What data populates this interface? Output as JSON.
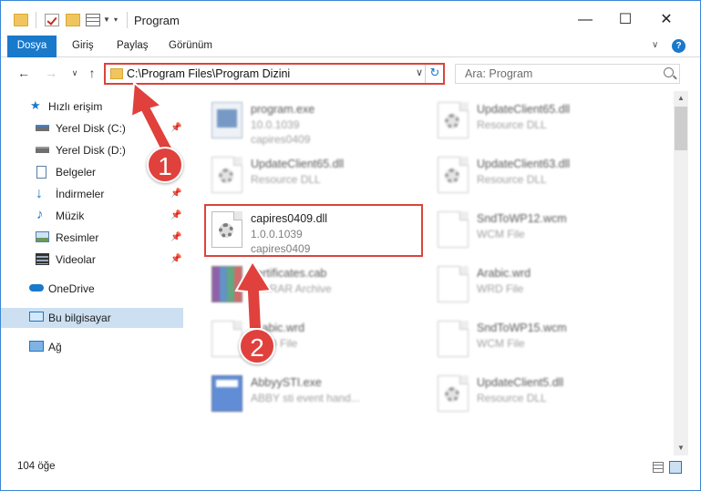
{
  "window": {
    "title": "Program",
    "controls": {
      "minimize": "—",
      "maximize": "☐",
      "close": "✕"
    }
  },
  "ribbon": {
    "tabs": [
      "Dosya",
      "Giriş",
      "Paylaş",
      "Görünüm"
    ],
    "help": "?"
  },
  "address": {
    "path": "C:\\Program Files\\Program Dizini"
  },
  "search": {
    "placeholder": "Ara: Program"
  },
  "sidebar": {
    "items": [
      {
        "label": "Hızlı erişim",
        "icon": "star-icon"
      },
      {
        "label": "Yerel Disk (C:)",
        "icon": "drive-icon",
        "pinned": true
      },
      {
        "label": "Yerel Disk (D:)",
        "icon": "drive-icon",
        "pinned": true
      },
      {
        "label": "Belgeler",
        "icon": "documents-icon",
        "pinned": true
      },
      {
        "label": "İndirmeler",
        "icon": "download-icon",
        "pinned": true
      },
      {
        "label": "Müzik",
        "icon": "music-icon",
        "pinned": true
      },
      {
        "label": "Resimler",
        "icon": "pictures-icon",
        "pinned": true
      },
      {
        "label": "Videolar",
        "icon": "videos-icon",
        "pinned": true
      },
      {
        "label": "OneDrive",
        "icon": "onedrive-icon"
      },
      {
        "label": "Bu bilgisayar",
        "icon": "computer-icon",
        "selected": true
      },
      {
        "label": "Ağ",
        "icon": "network-icon"
      }
    ]
  },
  "files": [
    {
      "name": "program.exe",
      "line2": "10.0.1039",
      "line3": "capires0409",
      "icon": "exe-icon"
    },
    {
      "name": "UpdateClient65.dll",
      "line2": "Resource DLL",
      "icon": "dll-icon"
    },
    {
      "name": "UpdateClient65.dll",
      "line2": "Resource DLL",
      "icon": "dll-icon"
    },
    {
      "name": "UpdateClient63.dll",
      "line2": "Resource DLL",
      "icon": "dll-icon"
    },
    {
      "name": "capires0409.dll",
      "line2": "1.0.0.1039",
      "line3": "capires0409",
      "icon": "dll-icon",
      "highlighted": true
    },
    {
      "name": "SndToWP12.wcm",
      "line2": "WCM File",
      "icon": "file-icon"
    },
    {
      "name": "certificates.cab",
      "line2": "WinRAR Archive",
      "icon": "winrar-icon"
    },
    {
      "name": "Arabic.wrd",
      "line2": "WRD File",
      "icon": "file-icon"
    },
    {
      "name": "Arabic.wrd",
      "line2": "WRD File",
      "icon": "file-icon"
    },
    {
      "name": "SndToWP15.wcm",
      "line2": "WCM File",
      "icon": "file-icon"
    },
    {
      "name": "AbbyySTI.exe",
      "line2": "ABBY sti event hand...",
      "icon": "abbyy-icon"
    },
    {
      "name": "UpdateClient5.dll",
      "line2": "Resource DLL",
      "icon": "dll-icon"
    }
  ],
  "status": {
    "item_count": "104 öğe"
  },
  "annotations": {
    "badge1": "1",
    "badge2": "2",
    "color": "#e0413c"
  }
}
